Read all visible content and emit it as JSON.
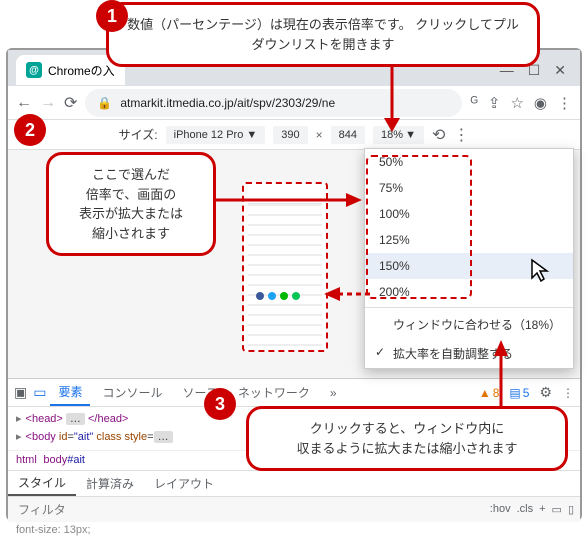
{
  "browser": {
    "tab_title": "Chromeの入",
    "url": "atmarkit.itmedia.co.jp/ait/spv/2303/29/ne"
  },
  "devtools_device": {
    "size_label": "サイズ:",
    "device": "iPhone 12 Pro",
    "width": "390",
    "height": "844",
    "zoom": "18%"
  },
  "zoom_menu": {
    "items": [
      "50%",
      "75%",
      "100%",
      "125%",
      "150%",
      "200%"
    ],
    "highlighted_index": 4,
    "fit": "ウィンドウに合わせる（18%）",
    "auto": "拡大率を自動調整する"
  },
  "dt": {
    "tabs": [
      "要素",
      "コンソール",
      "ソース",
      "ネットワーク"
    ],
    "warn_count": "8",
    "msg_count": "5",
    "dom_head": "<head>…</head>",
    "dom_body_open": "<body id=\"ait\" class style=…",
    "crumb_html": "html",
    "crumb_body": "body#ait",
    "sub_tabs": [
      "スタイル",
      "計算済み",
      "レイアウト"
    ],
    "filter_placeholder": "フィルタ",
    "filter_opts": [
      ":hov",
      ".cls",
      "+"
    ],
    "css_line": "font-size: 13px;"
  },
  "callouts": {
    "c1": "数値（パーセンテージ）は現在の表示倍率です。\nクリックしてプルダウンリストを開きます",
    "c2": "ここで選んだ\n倍率で、画面の\n表示が拡大または\n縮小されます",
    "c3": "クリックすると、ウィンドウ内に\n収まるように拡大または縮小されます"
  },
  "badges": {
    "b1": "1",
    "b2": "2",
    "b3": "3"
  }
}
